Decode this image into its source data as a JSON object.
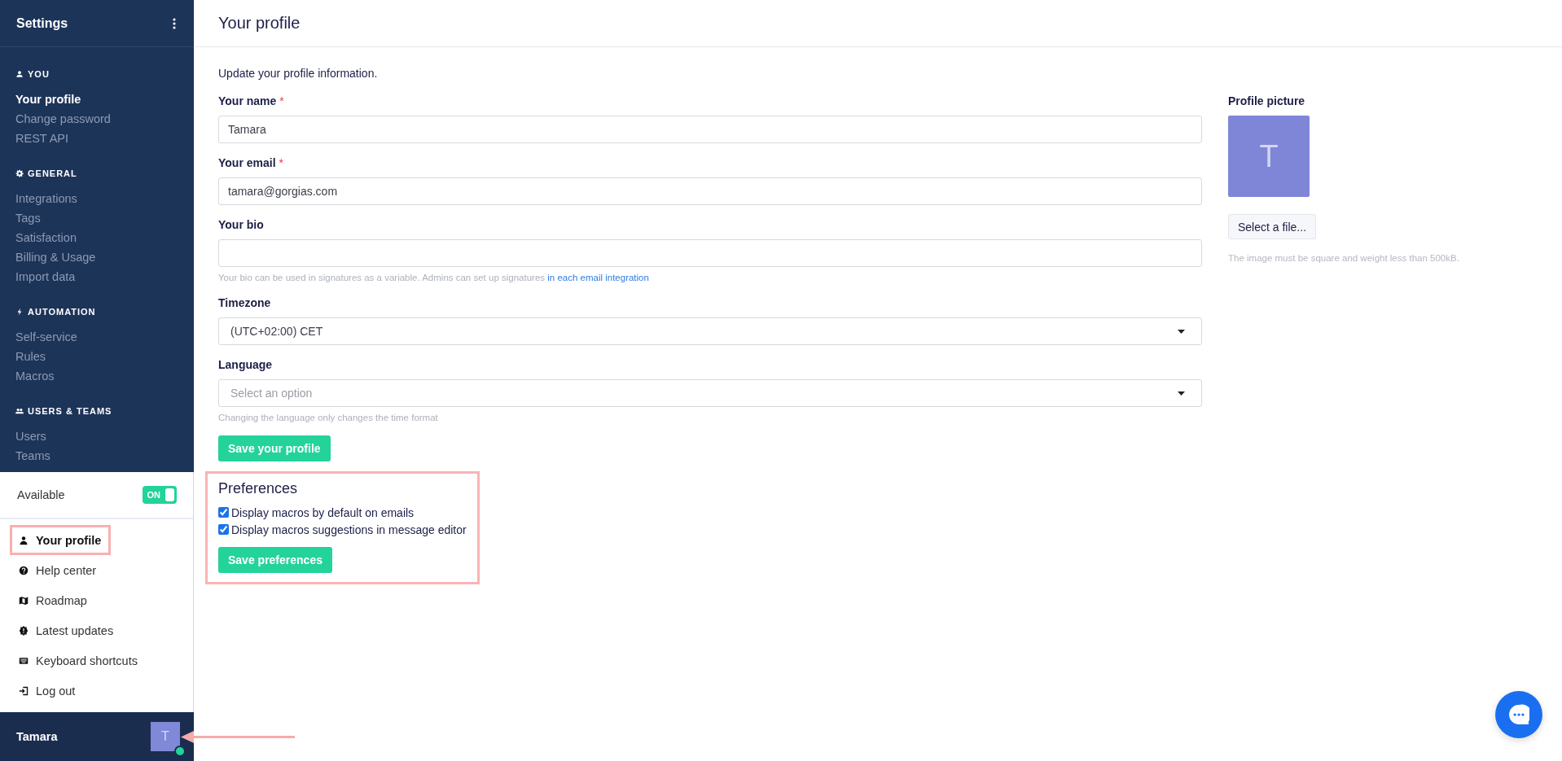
{
  "sidebar": {
    "title": "Settings",
    "sections": [
      {
        "heading": "YOU",
        "items": [
          {
            "label": "Your profile",
            "selected": true
          },
          {
            "label": "Change password",
            "selected": false
          },
          {
            "label": "REST API",
            "selected": false
          }
        ]
      },
      {
        "heading": "GENERAL",
        "items": [
          {
            "label": "Integrations",
            "selected": false
          },
          {
            "label": "Tags",
            "selected": false
          },
          {
            "label": "Satisfaction",
            "selected": false
          },
          {
            "label": "Billing & Usage",
            "selected": false
          },
          {
            "label": "Import data",
            "selected": false
          }
        ]
      },
      {
        "heading": "AUTOMATION",
        "items": [
          {
            "label": "Self-service",
            "selected": false
          },
          {
            "label": "Rules",
            "selected": false
          },
          {
            "label": "Macros",
            "selected": false
          }
        ]
      },
      {
        "heading": "USERS & TEAMS",
        "items": [
          {
            "label": "Users",
            "selected": false
          },
          {
            "label": "Teams",
            "selected": false
          }
        ]
      }
    ]
  },
  "status_menu": {
    "availability": {
      "label": "Available",
      "toggle_label": "ON",
      "on": true
    },
    "items": [
      {
        "label": "Your profile",
        "highlighted": true
      },
      {
        "label": "Help center",
        "highlighted": false
      },
      {
        "label": "Roadmap",
        "highlighted": false
      },
      {
        "label": "Latest updates",
        "highlighted": false
      },
      {
        "label": "Keyboard shortcuts",
        "highlighted": false
      },
      {
        "label": "Log out",
        "highlighted": false
      }
    ]
  },
  "user": {
    "name": "Tamara",
    "initial": "T",
    "online": true,
    "pointed_by_arrow": true
  },
  "page": {
    "title": "Your profile",
    "intro": "Update your profile information.",
    "fields": [
      {
        "kind": "text",
        "label": "Your name",
        "required_mark": "*",
        "value": "Tamara"
      },
      {
        "kind": "text",
        "label": "Your email",
        "required_mark": "*",
        "value": "tamara@gorgias.com"
      },
      {
        "kind": "text",
        "label": "Your bio",
        "hint": "Your bio can be used in signatures as a variable. Admins can set up signatures ",
        "hint_link": "in each email integration"
      },
      {
        "kind": "select",
        "label": "Timezone",
        "value": "(UTC+02:00) CET"
      },
      {
        "kind": "select",
        "label": "Language",
        "placeholder": "Select an option",
        "hint": "Changing the language only changes the time format"
      }
    ],
    "save_button": "Save your profile",
    "preferences": {
      "title": "Preferences",
      "highlighted": true,
      "options": [
        {
          "label": "Display macros by default on emails",
          "checked": true
        },
        {
          "label": "Display macros suggestions in message editor",
          "checked": true
        }
      ],
      "button": "Save preferences"
    },
    "profile_picture": {
      "label": "Profile picture",
      "initial": "T",
      "button": "Select a file...",
      "hint": "The image must be square and weight less than 500kB."
    }
  }
}
